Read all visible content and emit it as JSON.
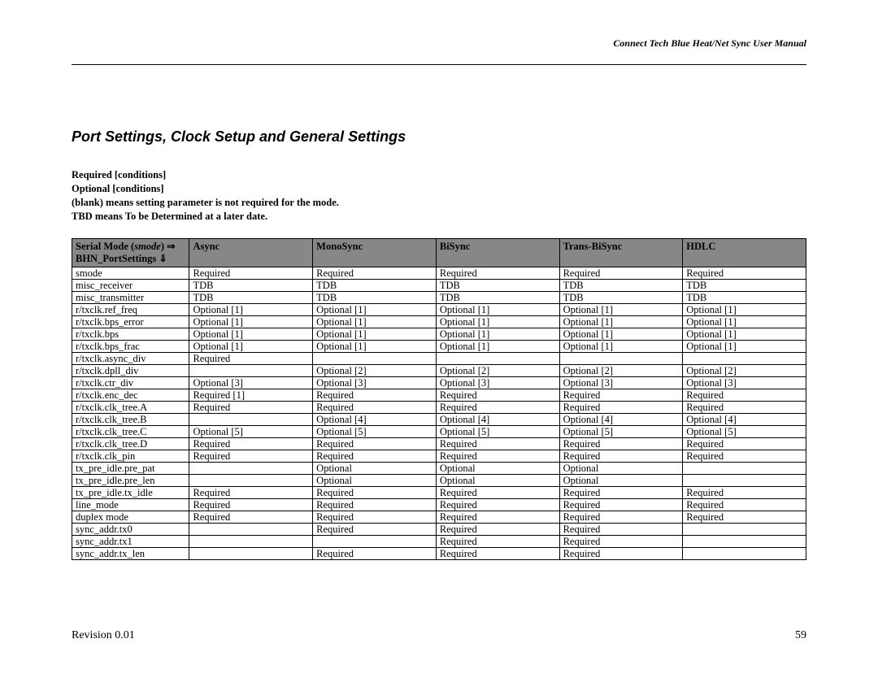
{
  "header_text": "Connect Tech Blue Heat/Net Sync User Manual",
  "section_title": "Port Settings, Clock Setup and General Settings",
  "legend": {
    "l1": "Required [conditions]",
    "l2": "Optional [conditions]",
    "l3": "(blank) means setting parameter is not required for the mode.",
    "l4": "TBD means To be Determined at a later date."
  },
  "table": {
    "header_left_line1_a": "Serial Mode (",
    "header_left_line1_b": "smode",
    "header_left_line1_c": ") ⇒",
    "header_left_line2": "BHN_PortSettings ⇓",
    "cols": [
      "Async",
      "MonoSync",
      "BiSync",
      "Trans-BiSync",
      "HDLC"
    ],
    "rows": [
      {
        "name": "smode",
        "cells": [
          "Required",
          "Required",
          "Required",
          "Required",
          "Required"
        ]
      },
      {
        "name": "misc_receiver",
        "cells": [
          "TDB",
          "TDB",
          "TDB",
          "TDB",
          "TDB"
        ]
      },
      {
        "name": "misc_transmitter",
        "cells": [
          "TDB",
          "TDB",
          "TDB",
          "TDB",
          "TDB"
        ]
      },
      {
        "name": "r/txclk.ref_freq",
        "cells": [
          "Optional [1]",
          "Optional [1]",
          "Optional [1]",
          "Optional [1]",
          "Optional [1]"
        ]
      },
      {
        "name": "r/txclk.bps_error",
        "cells": [
          "Optional [1]",
          "Optional [1]",
          "Optional [1]",
          "Optional [1]",
          "Optional [1]"
        ]
      },
      {
        "name": "r/txclk.bps",
        "cells": [
          "Optional [1]",
          "Optional [1]",
          "Optional [1]",
          "Optional [1]",
          "Optional [1]"
        ]
      },
      {
        "name": "r/txclk.bps_frac",
        "cells": [
          "Optional [1]",
          "Optional [1]",
          "Optional [1]",
          "Optional [1]",
          "Optional [1]"
        ]
      },
      {
        "name": "r/txclk.async_div",
        "cells": [
          "Required",
          "",
          "",
          "",
          ""
        ]
      },
      {
        "name": "r/txclk.dpll_div",
        "cells": [
          "",
          "Optional [2]",
          "Optional [2]",
          "Optional [2]",
          "Optional [2]"
        ]
      },
      {
        "name": "r/txclk.ctr_div",
        "cells": [
          "Optional [3]",
          "Optional [3]",
          "Optional [3]",
          "Optional [3]",
          "Optional [3]"
        ]
      },
      {
        "name": "r/txclk.enc_dec",
        "cells": [
          "Required [1]",
          "Required",
          "Required",
          "Required",
          "Required"
        ]
      },
      {
        "name": "r/txclk.clk_tree.A",
        "cells": [
          "Required",
          "Required",
          "Required",
          "Required",
          "Required"
        ]
      },
      {
        "name": "r/txclk.clk_tree.B",
        "cells": [
          "",
          "Optional [4]",
          "Optional [4]",
          "Optional [4]",
          "Optional [4]"
        ]
      },
      {
        "name": "r/txclk.clk_tree.C",
        "cells": [
          "Optional [5]",
          "Optional [5]",
          "Optional [5]",
          "Optional [5]",
          "Optional [5]"
        ]
      },
      {
        "name": "r/txclk.clk_tree.D",
        "cells": [
          "Required",
          "Required",
          "Required",
          "Required",
          "Required"
        ]
      },
      {
        "name": "r/txclk.clk_pin",
        "cells": [
          "Required",
          "Required",
          "Required",
          "Required",
          "Required"
        ]
      },
      {
        "name": "tx_pre_idle.pre_pat",
        "cells": [
          "",
          "Optional",
          "Optional",
          "Optional",
          ""
        ]
      },
      {
        "name": "tx_pre_idle.pre_len",
        "cells": [
          "",
          "Optional",
          "Optional",
          "Optional",
          ""
        ]
      },
      {
        "name": "tx_pre_idle.tx_idle",
        "cells": [
          "Required",
          "Required",
          "Required",
          "Required",
          "Required"
        ]
      },
      {
        "name": "line_mode",
        "cells": [
          "Required",
          "Required",
          "Required",
          "Required",
          "Required"
        ]
      },
      {
        "name": "duplex mode",
        "cells": [
          "Required",
          "Required",
          "Required",
          "Required",
          "Required"
        ]
      },
      {
        "name": "sync_addr.tx0",
        "cells": [
          "",
          "Required",
          "Required",
          "Required",
          ""
        ]
      },
      {
        "name": "sync_addr.tx1",
        "cells": [
          "",
          "",
          "Required",
          "Required",
          ""
        ]
      },
      {
        "name": "sync_addr.tx_len",
        "cells": [
          "",
          "Required",
          "Required",
          "Required",
          ""
        ]
      }
    ]
  },
  "footer": {
    "left": "Revision 0.01",
    "right": "59"
  }
}
